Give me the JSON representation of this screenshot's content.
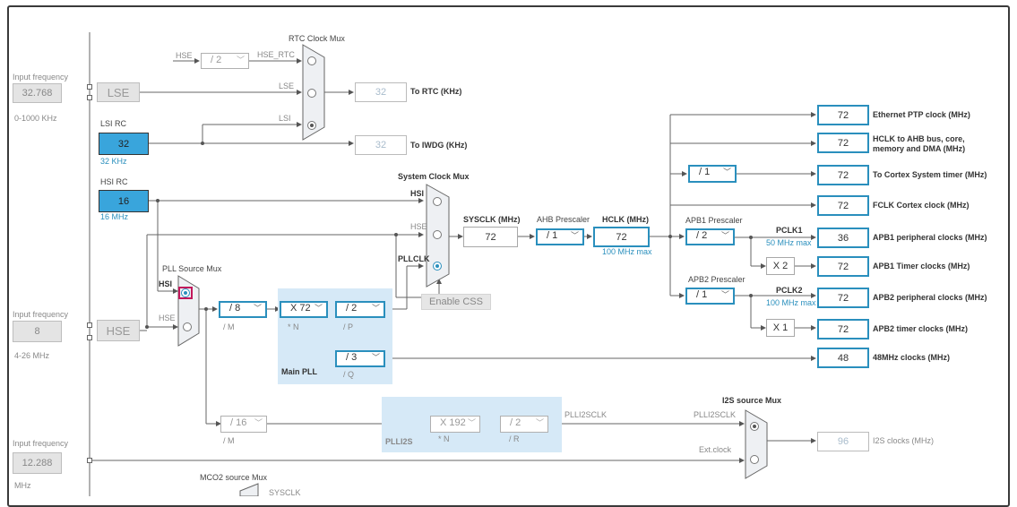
{
  "sources": {
    "lse": {
      "label_in": "Input frequency",
      "value": "32.768",
      "range": "0-1000 KHz",
      "name": "LSE"
    },
    "lsi": {
      "name": "LSI RC",
      "value": "32",
      "sub": "32 KHz"
    },
    "hsi": {
      "name": "HSI RC",
      "value": "16",
      "sub": "16 MHz"
    },
    "hse": {
      "label_in": "Input frequency",
      "value": "8",
      "range": "4-26 MHz",
      "name": "HSE"
    },
    "ext": {
      "label_in": "Input frequency",
      "value": "12.288",
      "range": "MHz"
    }
  },
  "rtc": {
    "title": "RTC Clock Mux",
    "hse_in": "HSE",
    "prescaler": "/ 2",
    "hse_rtc": "HSE_RTC",
    "lse_in": "LSE",
    "lsi_in": "LSI",
    "rtc_value": "32",
    "rtc_label": "To RTC (KHz)",
    "iwdg_value": "32",
    "iwdg_label": "To IWDG (KHz)"
  },
  "sysmux": {
    "title": "System Clock Mux",
    "hsi": "HSI",
    "hse": "HSE",
    "pllclk": "PLLCLK",
    "enable_css": "Enable CSS",
    "sysclk_label": "SYSCLK (MHz)",
    "sysclk_value": "72"
  },
  "ahb": {
    "label": "AHB Prescaler",
    "value": "/ 1",
    "hclk_label": "HCLK (MHz)",
    "hclk_value": "72",
    "hclk_max": "100 MHz max"
  },
  "cortex_prescaler": "/ 1",
  "apb1": {
    "label": "APB1 Prescaler",
    "value": "/ 2",
    "pclk_label": "PCLK1",
    "pclk_max": "50 MHz max",
    "timer_mult": "X 2"
  },
  "apb2": {
    "label": "APB2 Prescaler",
    "value": "/ 1",
    "pclk_label": "PCLK2",
    "pclk_max": "100 MHz max",
    "timer_mult": "X 1"
  },
  "outputs": [
    {
      "value": "72",
      "label": "Ethernet PTP clock (MHz)"
    },
    {
      "value": "72",
      "label": "HCLK to AHB bus, core,\nmemory and DMA (MHz)"
    },
    {
      "value": "72",
      "label": "To Cortex System timer (MHz)"
    },
    {
      "value": "72",
      "label": "FCLK Cortex clock (MHz)"
    },
    {
      "value": "36",
      "label": "APB1 peripheral clocks (MHz)"
    },
    {
      "value": "72",
      "label": "APB1 Timer clocks (MHz)"
    },
    {
      "value": "72",
      "label": "APB2 peripheral clocks (MHz)"
    },
    {
      "value": "72",
      "label": "APB2 timer clocks (MHz)"
    },
    {
      "value": "48",
      "label": "48MHz clocks (MHz)"
    }
  ],
  "pll": {
    "source_title": "PLL Source Mux",
    "hsi": "HSI",
    "hse": "HSE",
    "m_value": "/ 8",
    "m_label": "/ M",
    "n_value": "X 72",
    "n_label": "* N",
    "p_value": "/ 2",
    "p_label": "/ P",
    "q_value": "/ 3",
    "q_label": "/ Q",
    "title": "Main PLL"
  },
  "plli2s": {
    "m_value": "/ 16",
    "m_label": "/ M",
    "n_value": "X 192",
    "n_label": "* N",
    "r_value": "/ 2",
    "r_label": "/ R",
    "title": "PLLI2S",
    "out_label": "PLLI2SCLK"
  },
  "i2s": {
    "title": "I2S source Mux",
    "in1": "PLLI2SCLK",
    "in2": "Ext.clock",
    "value": "96",
    "label": "I2S clocks (MHz)"
  },
  "mco2": {
    "title": "MCO2 source Mux",
    "in1": "SYSCLK"
  }
}
